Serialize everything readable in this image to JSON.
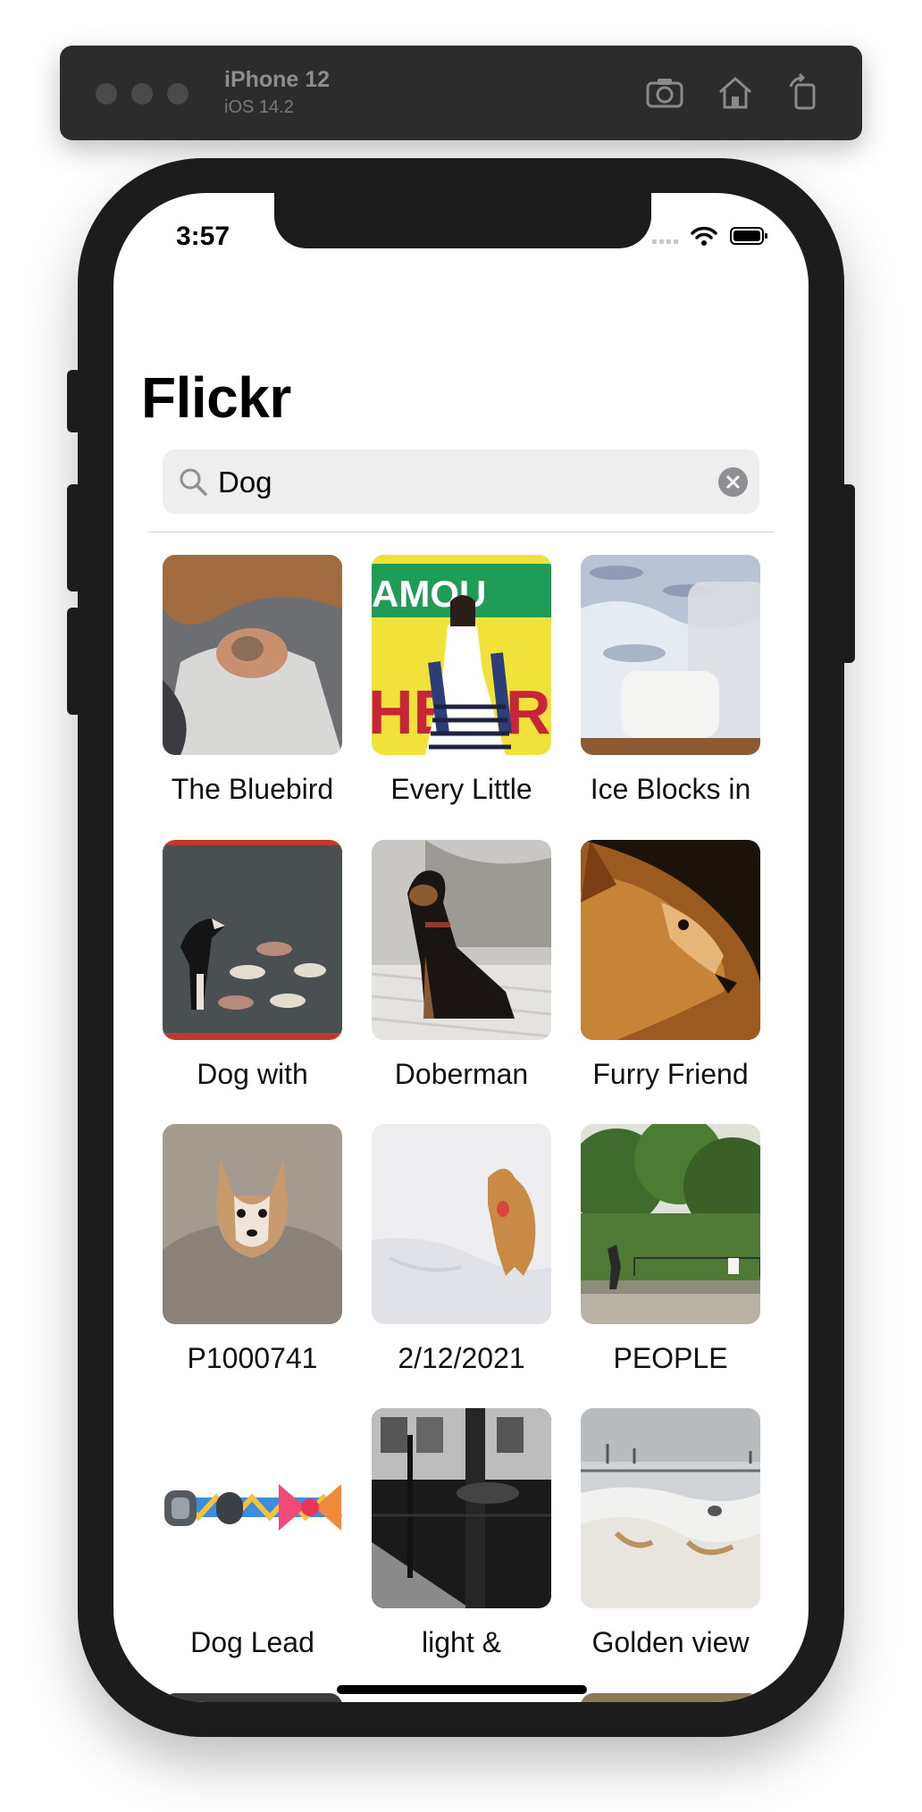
{
  "simulator": {
    "device_name": "iPhone 12",
    "os_version": "iOS 14.2",
    "toolbar_icons": [
      "camera-icon",
      "home-icon",
      "rotate-icon"
    ]
  },
  "status_bar": {
    "time": "3:57",
    "icons": [
      "cellular-icon",
      "wifi-icon",
      "battery-icon"
    ]
  },
  "nav": {
    "title": "Flickr"
  },
  "search": {
    "value": "Dog",
    "icon": "magnifier-icon",
    "clear_icon": "clear-x-icon"
  },
  "photos": [
    {
      "title": "The Bluebird"
    },
    {
      "title": "Every Little"
    },
    {
      "title": "Ice Blocks in"
    },
    {
      "title": "Dog with"
    },
    {
      "title": "Doberman"
    },
    {
      "title": "Furry Friend"
    },
    {
      "title": "P1000741"
    },
    {
      "title": "2/12/2021"
    },
    {
      "title": "PEOPLE"
    },
    {
      "title": "Dog Lead"
    },
    {
      "title": "light &"
    },
    {
      "title": "Golden view"
    }
  ]
}
